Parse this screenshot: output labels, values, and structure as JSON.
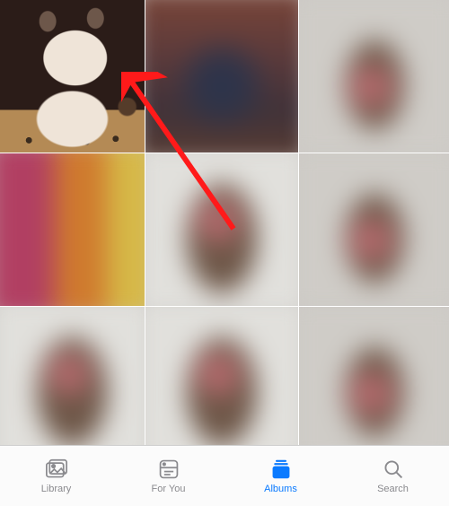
{
  "tabs": {
    "library": {
      "label": "Library",
      "active": false
    },
    "foryou": {
      "label": "For You",
      "active": false
    },
    "albums": {
      "label": "Albums",
      "active": true
    },
    "search": {
      "label": "Search",
      "active": false
    }
  },
  "annotation": {
    "arrow_color": "#ff1a1a"
  },
  "grid_items": [
    {
      "name": "photo-thumbnail-kitten",
      "interactable": true
    },
    {
      "name": "photo-thumbnail",
      "interactable": true
    },
    {
      "name": "photo-thumbnail",
      "interactable": true
    },
    {
      "name": "photo-thumbnail",
      "interactable": true
    },
    {
      "name": "photo-thumbnail",
      "interactable": true
    },
    {
      "name": "photo-thumbnail",
      "interactable": true
    },
    {
      "name": "photo-thumbnail",
      "interactable": true
    },
    {
      "name": "photo-thumbnail",
      "interactable": true
    },
    {
      "name": "photo-thumbnail",
      "interactable": true
    }
  ]
}
